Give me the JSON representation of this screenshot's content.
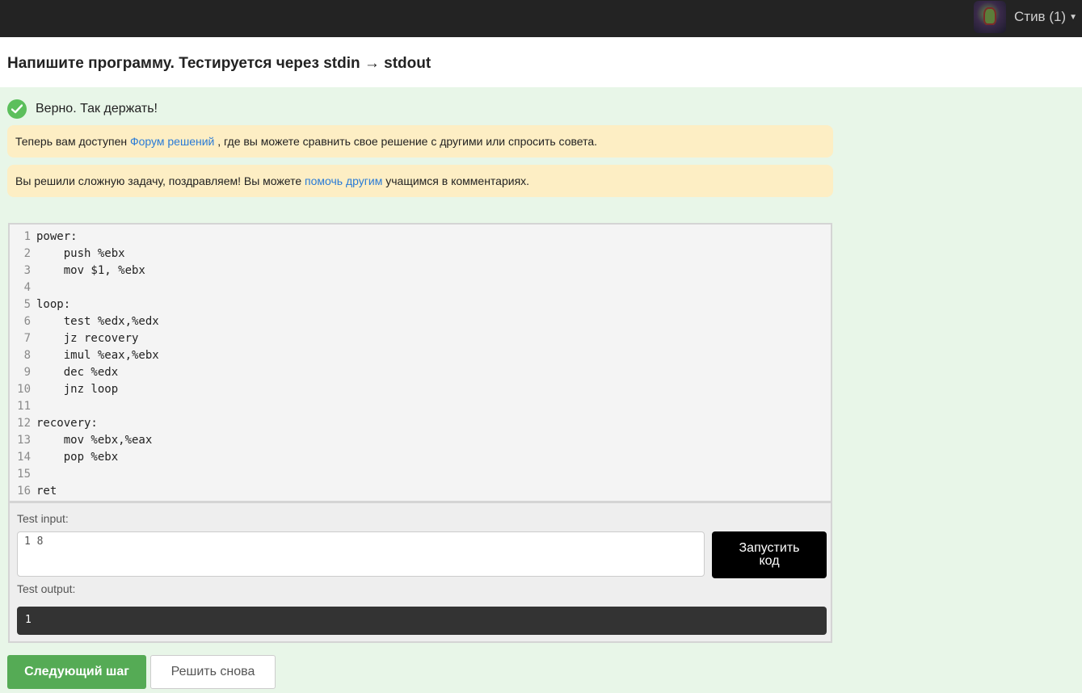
{
  "header": {
    "user_name": "Стив (1)"
  },
  "page": {
    "title": "Напишите программу. Тестируется через stdin → stdout"
  },
  "result": {
    "message": "Верно. Так держать!"
  },
  "notices": [
    {
      "before": "Теперь вам доступен ",
      "link": "Форум решений",
      "after": " , где вы можете сравнить свое решение с другими или спросить совета."
    },
    {
      "before": "Вы решили сложную задачу, поздравляем! Вы можете ",
      "link": "помочь другим",
      "after": " учащимся в комментариях."
    }
  ],
  "code": {
    "lines": [
      {
        "n": "1",
        "text": "power:"
      },
      {
        "n": "2",
        "text": "    push %ebx"
      },
      {
        "n": "3",
        "text": "    mov $1, %ebx"
      },
      {
        "n": "4",
        "text": ""
      },
      {
        "n": "5",
        "text": "loop:"
      },
      {
        "n": "6",
        "text": "    test %edx,%edx"
      },
      {
        "n": "7",
        "text": "    jz recovery"
      },
      {
        "n": "8",
        "text": "    imul %eax,%ebx"
      },
      {
        "n": "9",
        "text": "    dec %edx"
      },
      {
        "n": "10",
        "text": "    jnz loop"
      },
      {
        "n": "11",
        "text": ""
      },
      {
        "n": "12",
        "text": "recovery:"
      },
      {
        "n": "13",
        "text": "    mov %ebx,%eax"
      },
      {
        "n": "14",
        "text": "    pop %ebx"
      },
      {
        "n": "15",
        "text": ""
      },
      {
        "n": "16",
        "text": "ret"
      }
    ]
  },
  "test": {
    "input_label": "Test input:",
    "input_value": "1 8",
    "run_label_line1": "Запустить",
    "run_label_line2": "код",
    "output_label": "Test output:",
    "output_value": "1"
  },
  "actions": {
    "next_label": "Следующий шаг",
    "retry_label": "Решить снова"
  },
  "colors": {
    "success": "#5cbf5c",
    "next_button": "#55ab55",
    "notice_bg": "#fdeec4",
    "link": "#2a7bd6",
    "page_bg": "#e8f6e8"
  },
  "icons": {
    "verdict": "checkmark-circle-icon",
    "user_menu": "chevron-down-icon"
  }
}
